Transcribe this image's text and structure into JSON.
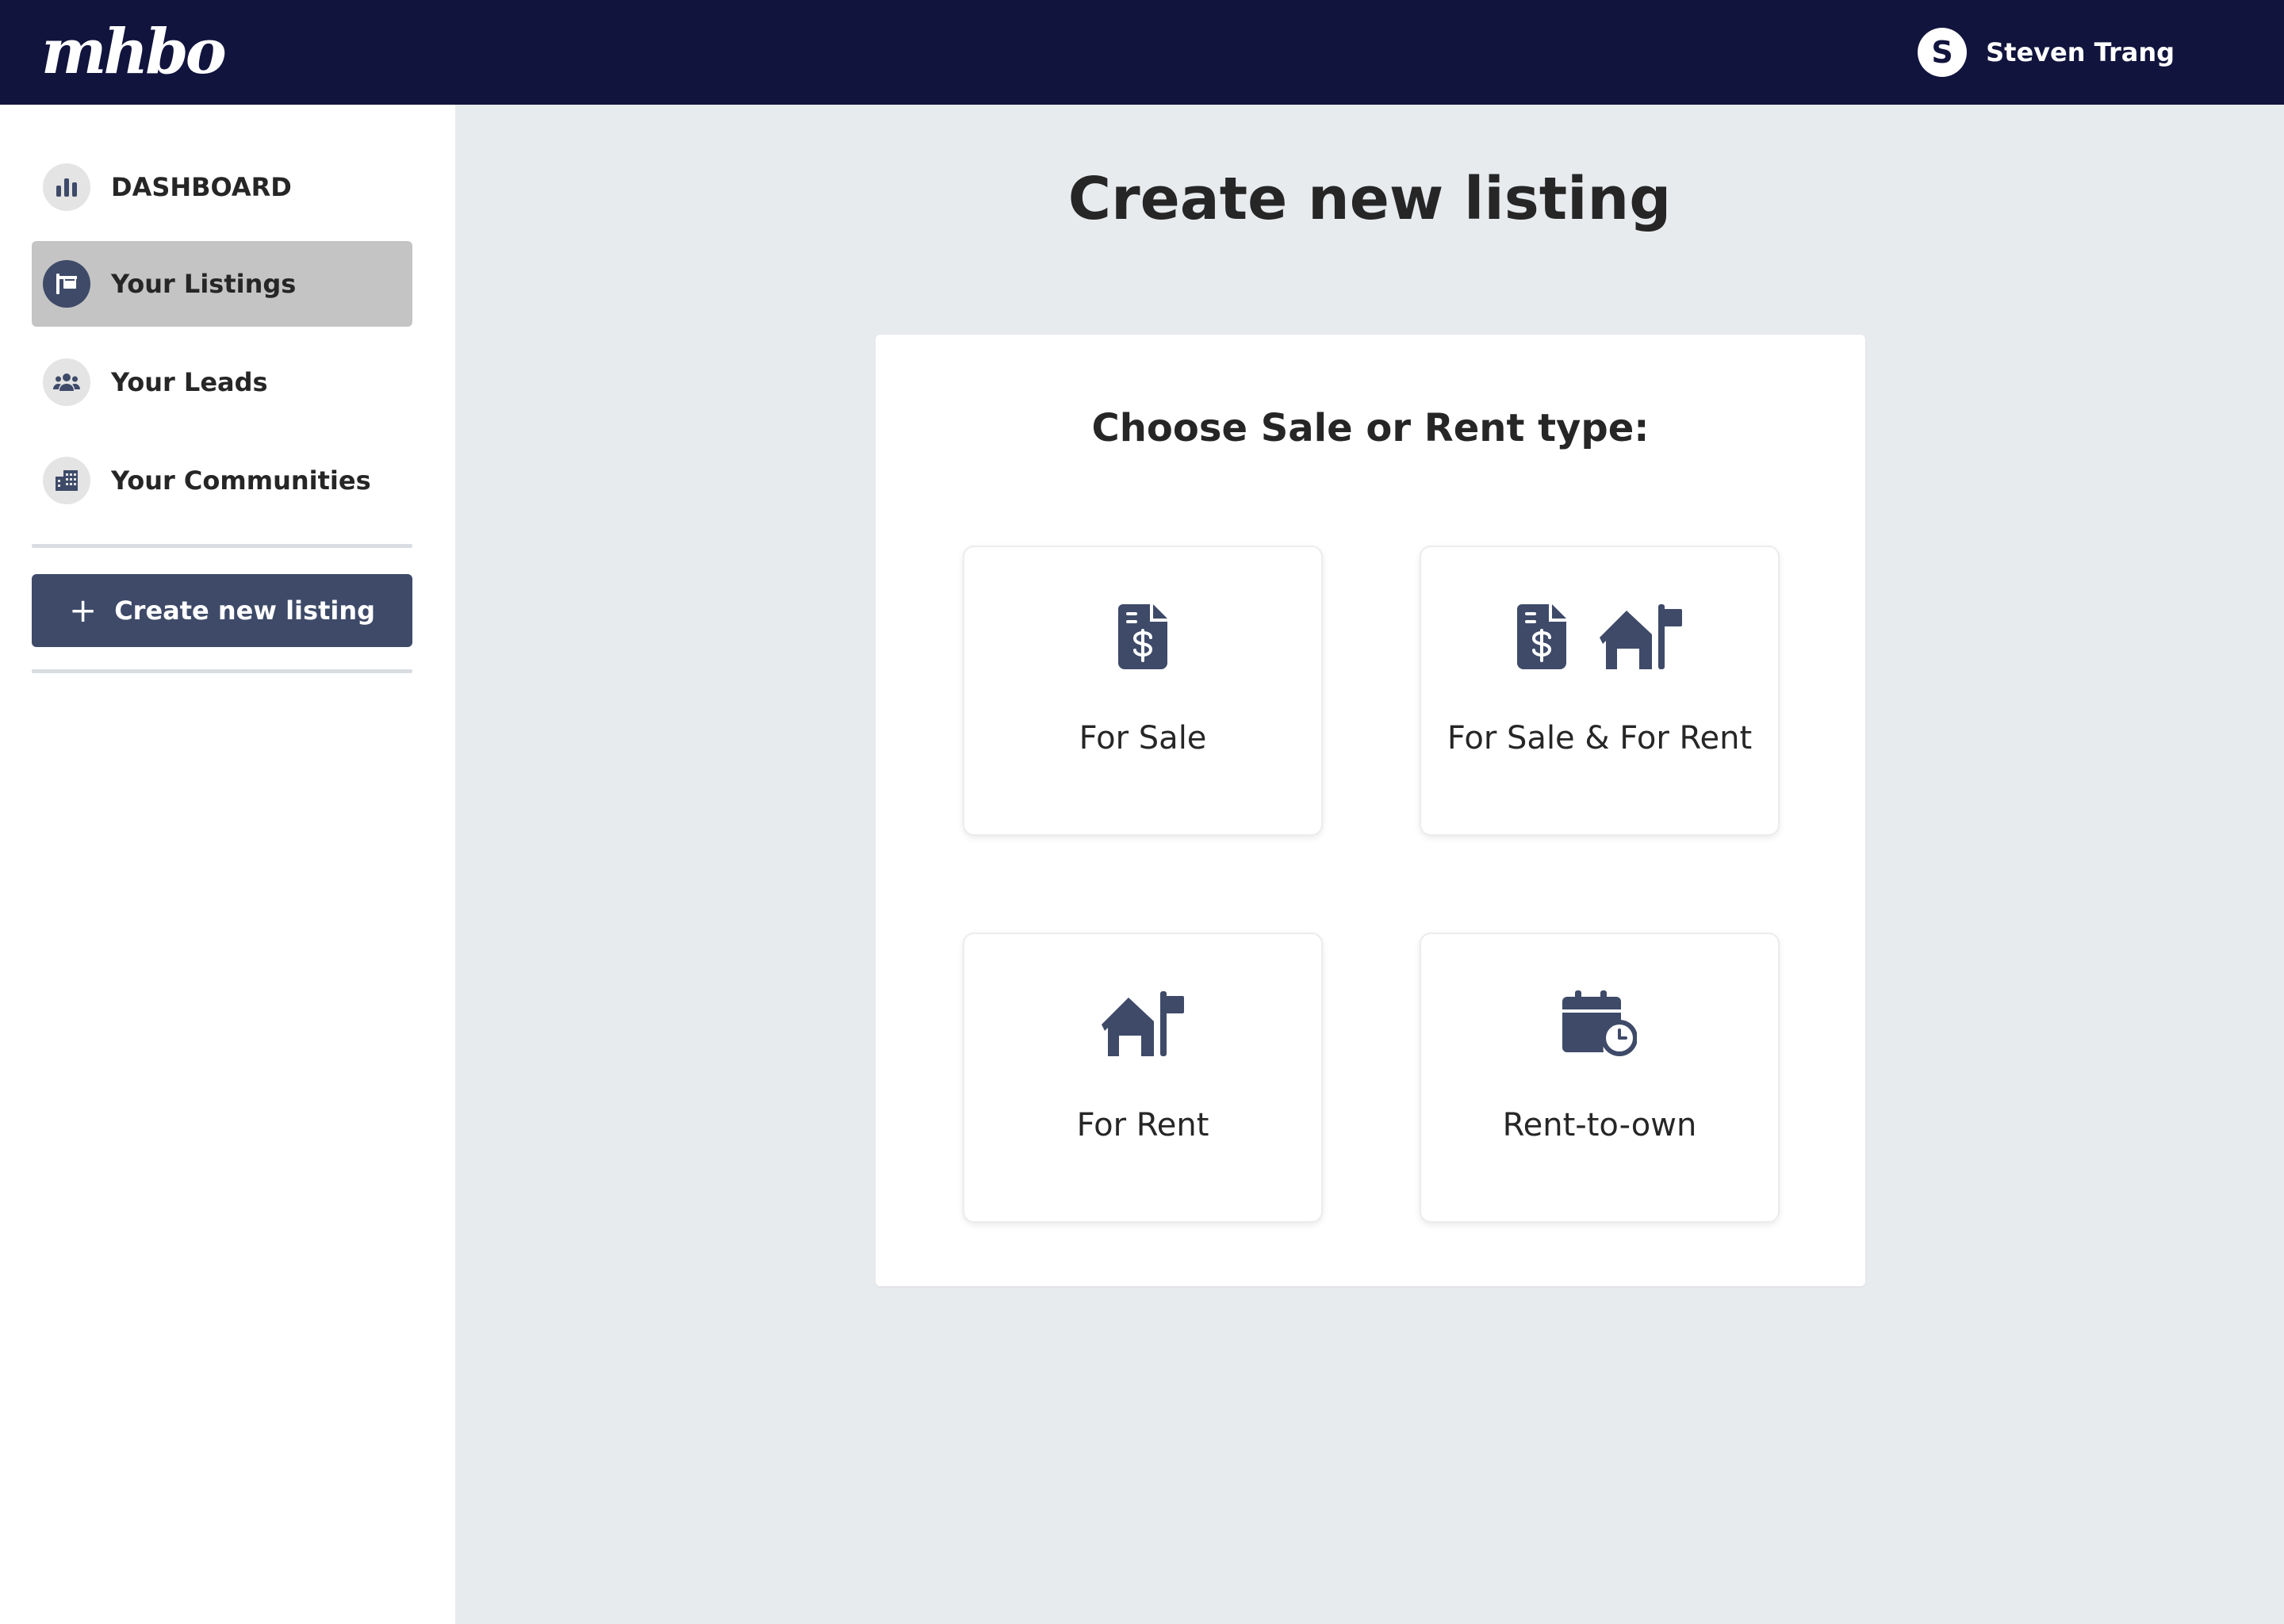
{
  "header": {
    "logo": "mhbo",
    "user": {
      "initial": "S",
      "name": "Steven Trang"
    }
  },
  "sidebar": {
    "items": [
      {
        "label": "DASHBOARD",
        "icon": "bar-chart-icon",
        "active": false
      },
      {
        "label": "Your Listings",
        "icon": "sign-post-icon",
        "active": true
      },
      {
        "label": "Your Leads",
        "icon": "users-icon",
        "active": false
      },
      {
        "label": "Your Communities",
        "icon": "building-icon",
        "active": false
      }
    ],
    "create_button": {
      "icon": "plus-icon",
      "label": "Create new listing"
    }
  },
  "main": {
    "title": "Create new listing",
    "subtitle": "Choose Sale or Rent type:",
    "options": [
      {
        "label": "For Sale",
        "icons": [
          "invoice-dollar-icon"
        ]
      },
      {
        "label": "For Sale & For Rent",
        "icons": [
          "invoice-dollar-icon",
          "house-flag-icon"
        ]
      },
      {
        "label": "For Rent",
        "icons": [
          "house-flag-icon"
        ]
      },
      {
        "label": "Rent-to-own",
        "icons": [
          "calendar-clock-icon"
        ]
      }
    ]
  },
  "colors": {
    "topbar": "#11143d",
    "accent": "#3e4a68",
    "active_nav": "#c4c4c4",
    "page_background": "#e8ebee"
  }
}
